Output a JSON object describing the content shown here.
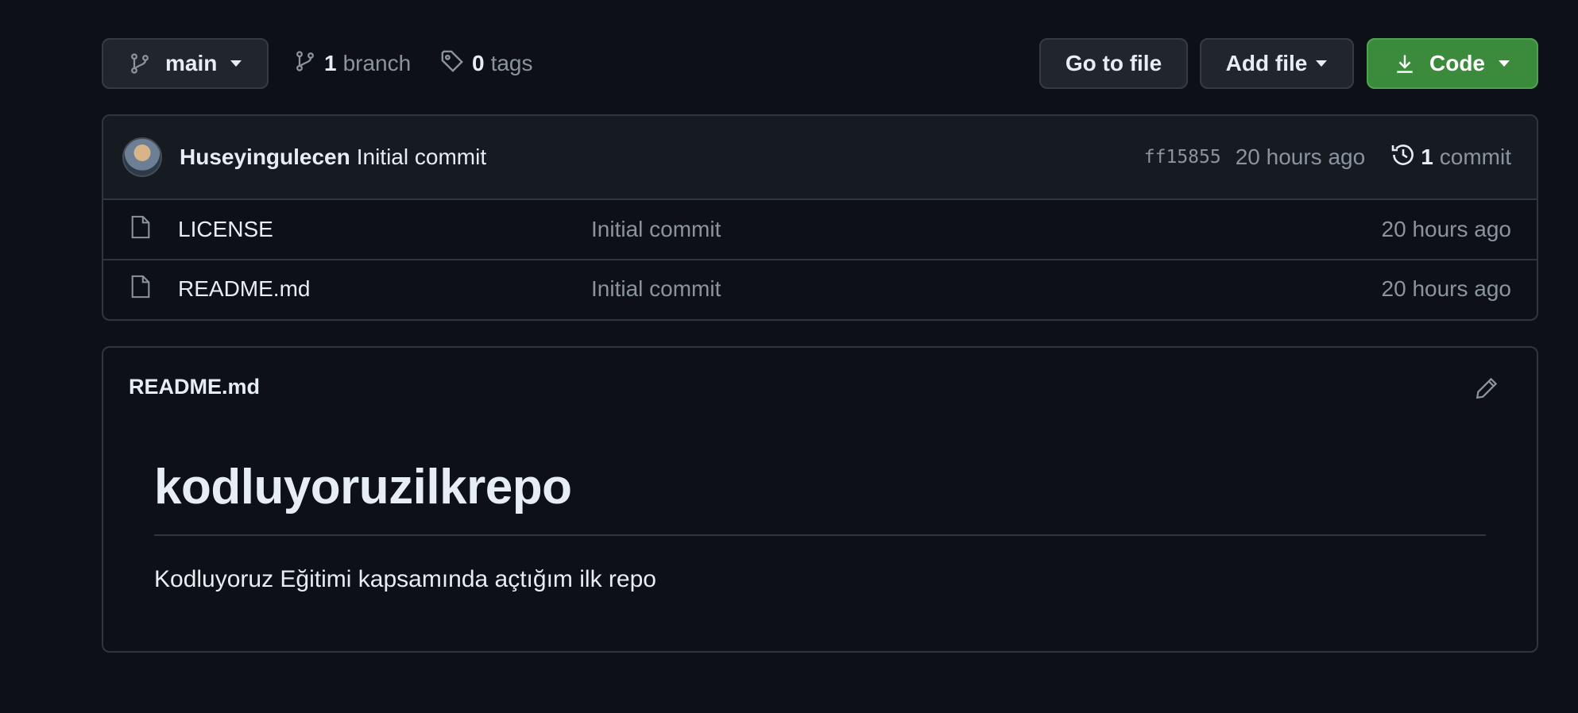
{
  "toolbar": {
    "branch_name": "main",
    "branch_count": "1",
    "branch_label": "branch",
    "tag_count": "0",
    "tag_label": "tags",
    "goto_label": "Go to file",
    "addfile_label": "Add file",
    "code_label": "Code"
  },
  "latest_commit": {
    "author": "Huseyingulecen",
    "message": "Initial commit",
    "sha": "ff15855",
    "time": "20 hours ago",
    "commit_count": "1",
    "commit_label": "commit"
  },
  "files": [
    {
      "name": "LICENSE",
      "message": "Initial commit",
      "time": "20 hours ago"
    },
    {
      "name": "README.md",
      "message": "Initial commit",
      "time": "20 hours ago"
    }
  ],
  "readme": {
    "filename": "README.md",
    "heading": "kodluyoruzilkrepo",
    "paragraph": "Kodluyoruz Eğitimi kapsamında açtığım ilk repo"
  },
  "colors": {
    "background": "#0d1117",
    "code_button": "#3c8b3c",
    "border": "#30363d"
  }
}
